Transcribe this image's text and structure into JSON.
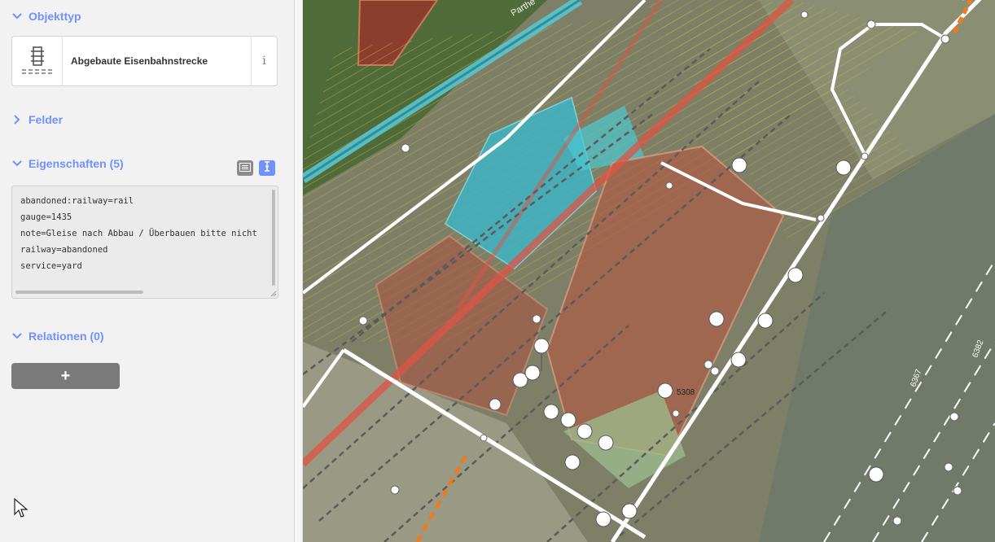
{
  "sidebar": {
    "object_type": {
      "title": "Objekttyp",
      "icon": "abandoned-railway-icon"
    },
    "preset": {
      "name": "Abgebaute Eisenbahnstrecke",
      "info_label": "i"
    },
    "fields": {
      "title": "Felder"
    },
    "properties": {
      "title": "Eigenschaften (5)",
      "tags": [
        "abandoned:railway=rail",
        "gauge=1435",
        "note=Gleise nach Abbau / Überbauen bitte nicht",
        "railway=abandoned",
        "service=yard"
      ]
    },
    "relations": {
      "title": "Relationen (0)",
      "add_label": "+"
    }
  },
  "map": {
    "labels": {
      "street": "Parthe",
      "ref1": "5308",
      "ref2": "6367",
      "ref3": "6382"
    }
  },
  "colors": {
    "accent": "#7092ff",
    "button_gray": "#7a7a7a",
    "panel_bg": "#f2f2f2"
  }
}
